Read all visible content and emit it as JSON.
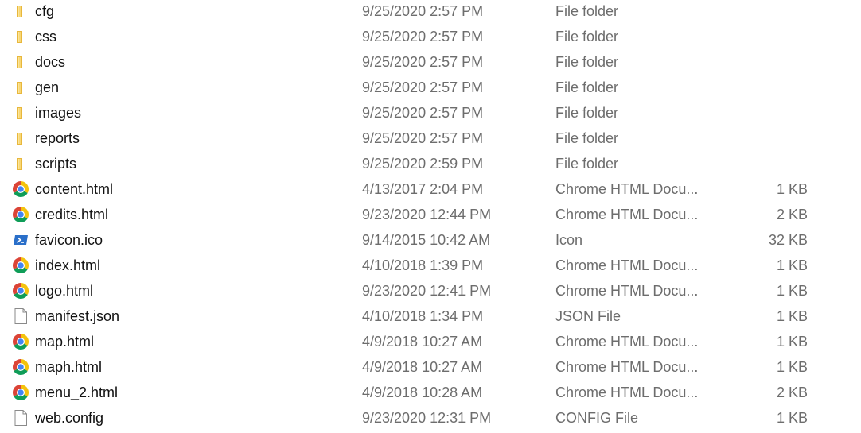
{
  "files": [
    {
      "name": "cfg",
      "date": "9/25/2020 2:57 PM",
      "type": "File folder",
      "size": "",
      "icon": "folder-icon"
    },
    {
      "name": "css",
      "date": "9/25/2020 2:57 PM",
      "type": "File folder",
      "size": "",
      "icon": "folder-icon"
    },
    {
      "name": "docs",
      "date": "9/25/2020 2:57 PM",
      "type": "File folder",
      "size": "",
      "icon": "folder-icon"
    },
    {
      "name": "gen",
      "date": "9/25/2020 2:57 PM",
      "type": "File folder",
      "size": "",
      "icon": "folder-icon"
    },
    {
      "name": "images",
      "date": "9/25/2020 2:57 PM",
      "type": "File folder",
      "size": "",
      "icon": "folder-icon"
    },
    {
      "name": "reports",
      "date": "9/25/2020 2:57 PM",
      "type": "File folder",
      "size": "",
      "icon": "folder-icon"
    },
    {
      "name": "scripts",
      "date": "9/25/2020 2:59 PM",
      "type": "File folder",
      "size": "",
      "icon": "folder-icon"
    },
    {
      "name": "content.html",
      "date": "4/13/2017 2:04 PM",
      "type": "Chrome HTML Docu...",
      "size": "1 KB",
      "icon": "chrome-icon"
    },
    {
      "name": "credits.html",
      "date": "9/23/2020 12:44 PM",
      "type": "Chrome HTML Docu...",
      "size": "2 KB",
      "icon": "chrome-icon"
    },
    {
      "name": "favicon.ico",
      "date": "9/14/2015 10:42 AM",
      "type": "Icon",
      "size": "32 KB",
      "icon": "powershell-icon"
    },
    {
      "name": "index.html",
      "date": "4/10/2018 1:39 PM",
      "type": "Chrome HTML Docu...",
      "size": "1 KB",
      "icon": "chrome-icon"
    },
    {
      "name": "logo.html",
      "date": "9/23/2020 12:41 PM",
      "type": "Chrome HTML Docu...",
      "size": "1 KB",
      "icon": "chrome-icon"
    },
    {
      "name": "manifest.json",
      "date": "4/10/2018 1:34 PM",
      "type": "JSON File",
      "size": "1 KB",
      "icon": "blank-file-icon"
    },
    {
      "name": "map.html",
      "date": "4/9/2018 10:27 AM",
      "type": "Chrome HTML Docu...",
      "size": "1 KB",
      "icon": "chrome-icon"
    },
    {
      "name": "maph.html",
      "date": "4/9/2018 10:27 AM",
      "type": "Chrome HTML Docu...",
      "size": "1 KB",
      "icon": "chrome-icon"
    },
    {
      "name": "menu_2.html",
      "date": "4/9/2018 10:28 AM",
      "type": "Chrome HTML Docu...",
      "size": "2 KB",
      "icon": "chrome-icon"
    },
    {
      "name": "web.config",
      "date": "9/23/2020 12:31 PM",
      "type": "CONFIG File",
      "size": "1 KB",
      "icon": "blank-file-icon"
    }
  ],
  "colors": {
    "folder": "#f8d775",
    "folder_dark": "#e8b73c",
    "chrome_red": "#db4437",
    "chrome_yellow": "#f4c20d",
    "chrome_green": "#0f9d58",
    "chrome_blue": "#4285f4",
    "powershell_blue": "#2a6fc9",
    "text_secondary": "#6d6d6d"
  }
}
